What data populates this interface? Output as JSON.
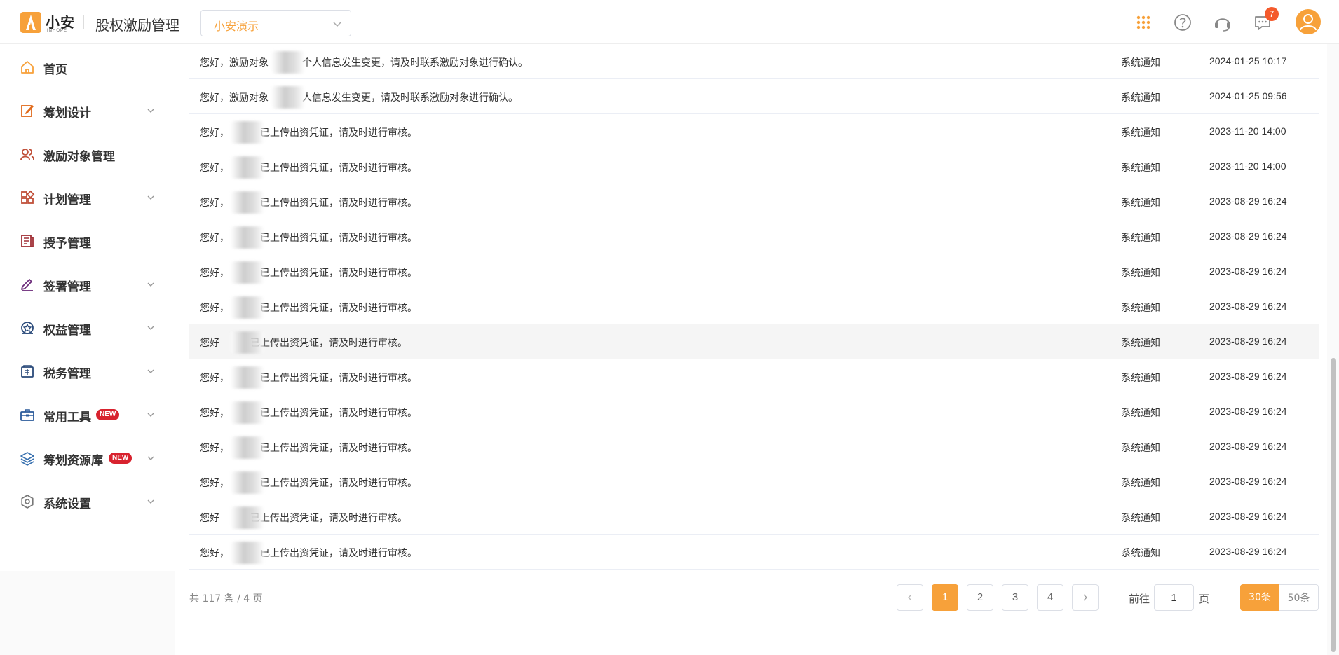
{
  "header": {
    "logo_name": "小安",
    "logo_sub": "INHOPE",
    "app_title": "股权激励管理",
    "company_select": "小安演示",
    "message_badge": "7"
  },
  "sidebar": {
    "items": [
      {
        "label": "首页",
        "icon": "home-icon",
        "expandable": false
      },
      {
        "label": "筹划设计",
        "icon": "edit-icon",
        "expandable": true
      },
      {
        "label": "激励对象管理",
        "icon": "users-icon",
        "expandable": false
      },
      {
        "label": "计划管理",
        "icon": "grid-icon",
        "expandable": true
      },
      {
        "label": "授予管理",
        "icon": "document-icon",
        "expandable": false
      },
      {
        "label": "签署管理",
        "icon": "sign-icon",
        "expandable": true
      },
      {
        "label": "权益管理",
        "icon": "shield-icon",
        "expandable": true
      },
      {
        "label": "税务管理",
        "icon": "tax-icon",
        "expandable": true
      },
      {
        "label": "常用工具",
        "icon": "toolbox-icon",
        "expandable": true,
        "badge": "NEW"
      },
      {
        "label": "筹划资源库",
        "icon": "layers-icon",
        "expandable": true,
        "badge": "NEW"
      },
      {
        "label": "系统设置",
        "icon": "settings-icon",
        "expandable": true
      }
    ]
  },
  "notifications": {
    "rows": [
      {
        "prefix": "您好，激励对象",
        "suffix": "个人信息发生变更，请及时联系激励对象进行确认。",
        "type": "系统通知",
        "time": "2024-01-25 10:17"
      },
      {
        "prefix": "您好，激励对象",
        "suffix": "人信息发生变更，请及时联系激励对象进行确认。",
        "type": "系统通知",
        "time": "2024-01-25 09:56"
      },
      {
        "prefix": "您好，",
        "suffix": "已上传出资凭证，请及时进行审核。",
        "type": "系统通知",
        "time": "2023-11-20 14:00"
      },
      {
        "prefix": "您好，",
        "suffix": "已上传出资凭证，请及时进行审核。",
        "type": "系统通知",
        "time": "2023-11-20 14:00"
      },
      {
        "prefix": "您好，",
        "suffix": "已上传出资凭证，请及时进行审核。",
        "type": "系统通知",
        "time": "2023-08-29 16:24"
      },
      {
        "prefix": "您好，",
        "suffix": "已上传出资凭证，请及时进行审核。",
        "type": "系统通知",
        "time": "2023-08-29 16:24"
      },
      {
        "prefix": "您好，",
        "suffix": "已上传出资凭证，请及时进行审核。",
        "type": "系统通知",
        "time": "2023-08-29 16:24"
      },
      {
        "prefix": "您好，",
        "suffix": "已上传出资凭证，请及时进行审核。",
        "type": "系统通知",
        "time": "2023-08-29 16:24"
      },
      {
        "prefix": "您好",
        "suffix": "已上传出资凭证，请及时进行审核。",
        "type": "系统通知",
        "time": "2023-08-29 16:24"
      },
      {
        "prefix": "您好，",
        "suffix": "已上传出资凭证，请及时进行审核。",
        "type": "系统通知",
        "time": "2023-08-29 16:24"
      },
      {
        "prefix": "您好，",
        "suffix": "已上传出资凭证，请及时进行审核。",
        "type": "系统通知",
        "time": "2023-08-29 16:24"
      },
      {
        "prefix": "您好，",
        "suffix": "已上传出资凭证，请及时进行审核。",
        "type": "系统通知",
        "time": "2023-08-29 16:24"
      },
      {
        "prefix": "您好，",
        "suffix": "已上传出资凭证，请及时进行审核。",
        "type": "系统通知",
        "time": "2023-08-29 16:24"
      },
      {
        "prefix": "您好",
        "suffix": "已上传出资凭证，请及时进行审核。",
        "type": "系统通知",
        "time": "2023-08-29 16:24"
      },
      {
        "prefix": "您好，",
        "suffix": "已上传出资凭证，请及时进行审核。",
        "type": "系统通知",
        "time": "2023-08-29 16:24"
      }
    ]
  },
  "pagination": {
    "total_text": "共 117 条 / 4 页",
    "pages": [
      "1",
      "2",
      "3",
      "4"
    ],
    "current_page": "1",
    "goto_label": "前往",
    "goto_value": "1",
    "page_unit": "页",
    "size_30": "30条",
    "size_50": "50条"
  },
  "colors": {
    "accent": "#f7a13a",
    "badge_red": "#f45a2c",
    "new_red": "#d8222e"
  }
}
